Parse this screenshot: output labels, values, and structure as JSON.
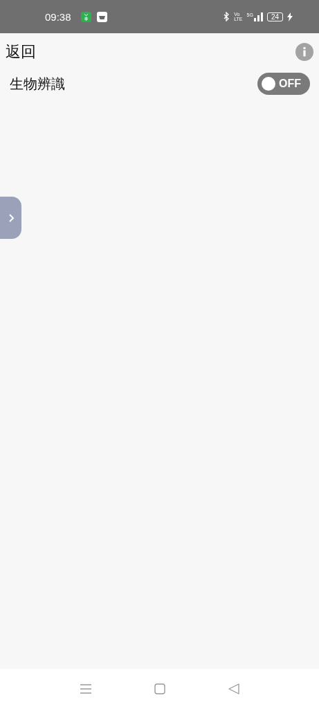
{
  "status_bar": {
    "time": "09:38",
    "volte": [
      "Vo",
      "LTE"
    ],
    "network": "5G",
    "battery": "24",
    "charging": true
  },
  "header": {
    "back": "返回"
  },
  "settings": [
    {
      "kind": "toggle",
      "label": "生物辨識",
      "on": false,
      "state_label": "OFF"
    }
  ],
  "side_tab": {
    "expanded": false
  }
}
